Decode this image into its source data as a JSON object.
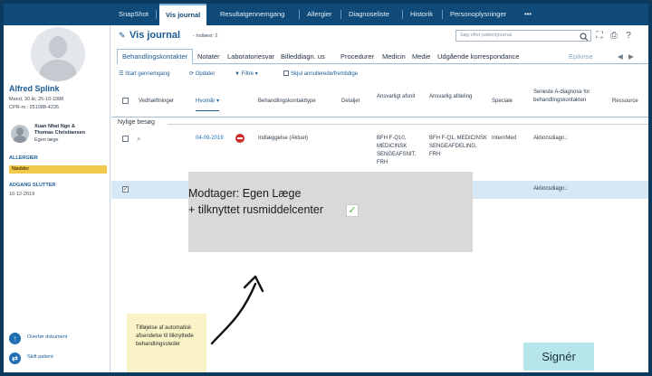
{
  "topnav": {
    "items": [
      "SnapShot",
      "Vis journal",
      "Resultatgennemgang",
      "Allergier",
      "Diagnoseliste",
      "Historik",
      "Personoplysninger",
      "•••"
    ],
    "active_index": 1
  },
  "patient": {
    "name": "Alfred Splink",
    "info_line1": "Mand, 30 år, 25-10-1988",
    "info_line2": "CPR-nr.: 251088-4235"
  },
  "care_team": {
    "names": "Xuan Nhat Ngo &",
    "names2": "Thomas Christiansen",
    "role": "Egen læge"
  },
  "allergies": {
    "heading": "ALLERGIER",
    "item": "Nødder"
  },
  "access": {
    "heading": "ADGANG SLUTTER",
    "date": "10-12-2019"
  },
  "side_actions": {
    "transfer_doc": "Overfør dokument",
    "switch_patient": "Skift patient"
  },
  "journal": {
    "title": "Vis journal",
    "subtitle": "- Indlæst: 2",
    "search_placeholder": "Søg efter patientjournal"
  },
  "tabs": [
    "Behandlingskontakter",
    "Notater",
    "Laboratoriesvar",
    "Billeddiagn. us",
    "Procedurer",
    "Medicin",
    "Medie",
    "Udgående korrespondance",
    "Epikrise"
  ],
  "toolbar": {
    "start": "Start gennemgang",
    "refresh": "Opdater",
    "filter": "Filtre",
    "hide": "Skjul annullerede/fremtidige"
  },
  "table": {
    "headers": {
      "attachments": "Vedhæftninger",
      "when": "Hvornår",
      "contact_type": "Behandlingskontakttype",
      "details": "Detaljer",
      "resp_section": "Ansvarligt afsnit",
      "resp_dept": "Ansvarlig afdeling",
      "specialty": "Speciale",
      "latest_diag": "Seneste A-diagnose for behandlingskontakten",
      "resource": "Ressource"
    },
    "group_label": "Nylige besøg",
    "row1": {
      "date": "04-09-2019",
      "type": "Indlæggelse (Aktuel)",
      "section": "BFH F-Q10, MEDICINSK SENGEAFSNIT, FRH",
      "dept": "BFH F-Q1, MEDICINSK SENGEAFDELING, FRH",
      "specialty": "InternMed",
      "diag": "Aktionsdiagn.:"
    },
    "row2": {
      "diag": "Aktionsdiagn.:"
    }
  },
  "overlay": {
    "line1": "Modtager: Egen Læge",
    "line2": "+ tilknyttet rusmiddelcenter",
    "check": "✓"
  },
  "note": {
    "text": "Tilføjelse af automatisk afsendelse til tilknyttede behandlingssteder"
  },
  "sign_button": "Signér"
}
